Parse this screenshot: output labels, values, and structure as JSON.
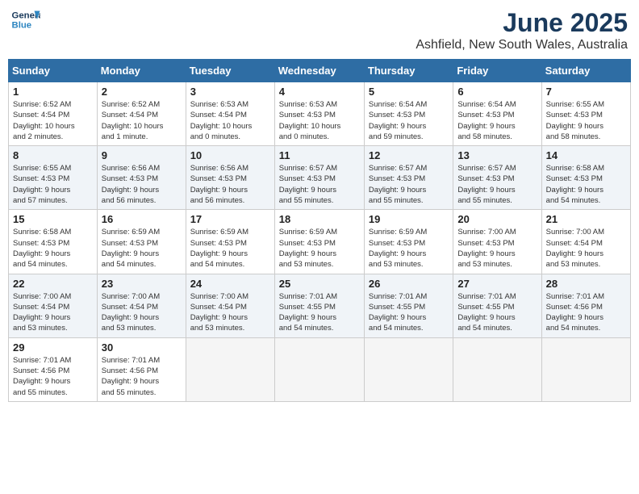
{
  "logo": {
    "line1": "General",
    "line2": "Blue"
  },
  "title": "June 2025",
  "location": "Ashfield, New South Wales, Australia",
  "weekdays": [
    "Sunday",
    "Monday",
    "Tuesday",
    "Wednesday",
    "Thursday",
    "Friday",
    "Saturday"
  ],
  "weeks": [
    [
      {
        "day": "1",
        "info": "Sunrise: 6:52 AM\nSunset: 4:54 PM\nDaylight: 10 hours\nand 2 minutes."
      },
      {
        "day": "2",
        "info": "Sunrise: 6:52 AM\nSunset: 4:54 PM\nDaylight: 10 hours\nand 1 minute."
      },
      {
        "day": "3",
        "info": "Sunrise: 6:53 AM\nSunset: 4:54 PM\nDaylight: 10 hours\nand 0 minutes."
      },
      {
        "day": "4",
        "info": "Sunrise: 6:53 AM\nSunset: 4:53 PM\nDaylight: 10 hours\nand 0 minutes."
      },
      {
        "day": "5",
        "info": "Sunrise: 6:54 AM\nSunset: 4:53 PM\nDaylight: 9 hours\nand 59 minutes."
      },
      {
        "day": "6",
        "info": "Sunrise: 6:54 AM\nSunset: 4:53 PM\nDaylight: 9 hours\nand 58 minutes."
      },
      {
        "day": "7",
        "info": "Sunrise: 6:55 AM\nSunset: 4:53 PM\nDaylight: 9 hours\nand 58 minutes."
      }
    ],
    [
      {
        "day": "8",
        "info": "Sunrise: 6:55 AM\nSunset: 4:53 PM\nDaylight: 9 hours\nand 57 minutes."
      },
      {
        "day": "9",
        "info": "Sunrise: 6:56 AM\nSunset: 4:53 PM\nDaylight: 9 hours\nand 56 minutes."
      },
      {
        "day": "10",
        "info": "Sunrise: 6:56 AM\nSunset: 4:53 PM\nDaylight: 9 hours\nand 56 minutes."
      },
      {
        "day": "11",
        "info": "Sunrise: 6:57 AM\nSunset: 4:53 PM\nDaylight: 9 hours\nand 55 minutes."
      },
      {
        "day": "12",
        "info": "Sunrise: 6:57 AM\nSunset: 4:53 PM\nDaylight: 9 hours\nand 55 minutes."
      },
      {
        "day": "13",
        "info": "Sunrise: 6:57 AM\nSunset: 4:53 PM\nDaylight: 9 hours\nand 55 minutes."
      },
      {
        "day": "14",
        "info": "Sunrise: 6:58 AM\nSunset: 4:53 PM\nDaylight: 9 hours\nand 54 minutes."
      }
    ],
    [
      {
        "day": "15",
        "info": "Sunrise: 6:58 AM\nSunset: 4:53 PM\nDaylight: 9 hours\nand 54 minutes."
      },
      {
        "day": "16",
        "info": "Sunrise: 6:59 AM\nSunset: 4:53 PM\nDaylight: 9 hours\nand 54 minutes."
      },
      {
        "day": "17",
        "info": "Sunrise: 6:59 AM\nSunset: 4:53 PM\nDaylight: 9 hours\nand 54 minutes."
      },
      {
        "day": "18",
        "info": "Sunrise: 6:59 AM\nSunset: 4:53 PM\nDaylight: 9 hours\nand 53 minutes."
      },
      {
        "day": "19",
        "info": "Sunrise: 6:59 AM\nSunset: 4:53 PM\nDaylight: 9 hours\nand 53 minutes."
      },
      {
        "day": "20",
        "info": "Sunrise: 7:00 AM\nSunset: 4:53 PM\nDaylight: 9 hours\nand 53 minutes."
      },
      {
        "day": "21",
        "info": "Sunrise: 7:00 AM\nSunset: 4:54 PM\nDaylight: 9 hours\nand 53 minutes."
      }
    ],
    [
      {
        "day": "22",
        "info": "Sunrise: 7:00 AM\nSunset: 4:54 PM\nDaylight: 9 hours\nand 53 minutes."
      },
      {
        "day": "23",
        "info": "Sunrise: 7:00 AM\nSunset: 4:54 PM\nDaylight: 9 hours\nand 53 minutes."
      },
      {
        "day": "24",
        "info": "Sunrise: 7:00 AM\nSunset: 4:54 PM\nDaylight: 9 hours\nand 53 minutes."
      },
      {
        "day": "25",
        "info": "Sunrise: 7:01 AM\nSunset: 4:55 PM\nDaylight: 9 hours\nand 54 minutes."
      },
      {
        "day": "26",
        "info": "Sunrise: 7:01 AM\nSunset: 4:55 PM\nDaylight: 9 hours\nand 54 minutes."
      },
      {
        "day": "27",
        "info": "Sunrise: 7:01 AM\nSunset: 4:55 PM\nDaylight: 9 hours\nand 54 minutes."
      },
      {
        "day": "28",
        "info": "Sunrise: 7:01 AM\nSunset: 4:56 PM\nDaylight: 9 hours\nand 54 minutes."
      }
    ],
    [
      {
        "day": "29",
        "info": "Sunrise: 7:01 AM\nSunset: 4:56 PM\nDaylight: 9 hours\nand 55 minutes."
      },
      {
        "day": "30",
        "info": "Sunrise: 7:01 AM\nSunset: 4:56 PM\nDaylight: 9 hours\nand 55 minutes."
      },
      {
        "day": "",
        "info": ""
      },
      {
        "day": "",
        "info": ""
      },
      {
        "day": "",
        "info": ""
      },
      {
        "day": "",
        "info": ""
      },
      {
        "day": "",
        "info": ""
      }
    ]
  ]
}
